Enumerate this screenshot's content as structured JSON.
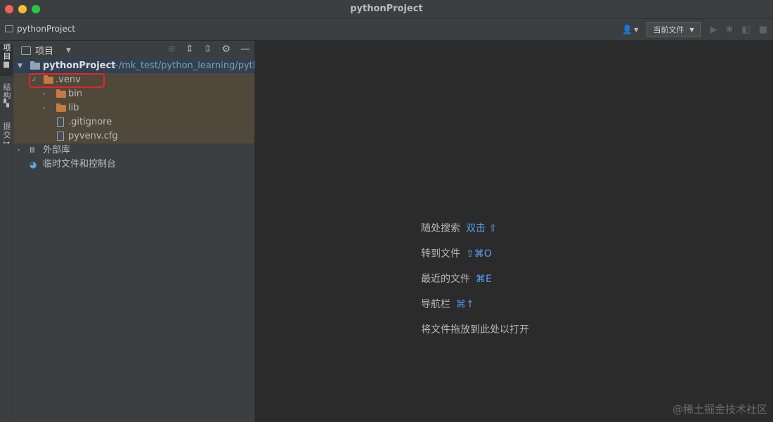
{
  "window": {
    "title": "pythonProject"
  },
  "navbar": {
    "project_name": "pythonProject",
    "run_config": "当前文件"
  },
  "left_strip": {
    "tabs": [
      {
        "label": "项目",
        "icon": "folder-icon"
      },
      {
        "label": "结构",
        "icon": "structure-icon"
      },
      {
        "label": "提交",
        "icon": "commit-icon"
      }
    ]
  },
  "project_panel": {
    "title": "项目",
    "icons": [
      "locate-icon",
      "expand-all-icon",
      "collapse-all-icon",
      "gear-icon",
      "minimize-icon"
    ],
    "tree": {
      "root": {
        "name": "pythonProject",
        "path": "~/mk_test/python_learning/pythonProject"
      },
      "venv": {
        "name": ".venv"
      },
      "bin": {
        "name": "bin"
      },
      "lib": {
        "name": "lib"
      },
      "gitignore": {
        "name": ".gitignore"
      },
      "pyvenv": {
        "name": "pyvenv.cfg"
      },
      "external_libs": {
        "name": "外部库"
      },
      "scratches": {
        "name": "临时文件和控制台"
      }
    }
  },
  "editor": {
    "hints": [
      {
        "label": "随处搜索",
        "shortcut": "双击 ⇧"
      },
      {
        "label": "转到文件",
        "shortcut": "⇧⌘O"
      },
      {
        "label": "最近的文件",
        "shortcut": "⌘E"
      },
      {
        "label": "导航栏",
        "shortcut": "⌘↑"
      },
      {
        "label": "将文件拖放到此处以打开",
        "shortcut": ""
      }
    ]
  },
  "watermark": "@稀土掘金技术社区",
  "colors": {
    "accent_shortcut": "#589df6",
    "highlight_box": "#e8232d",
    "folder": "#c77944",
    "panel_bg": "#3c3f41",
    "editor_bg": "#2b2b2b"
  }
}
